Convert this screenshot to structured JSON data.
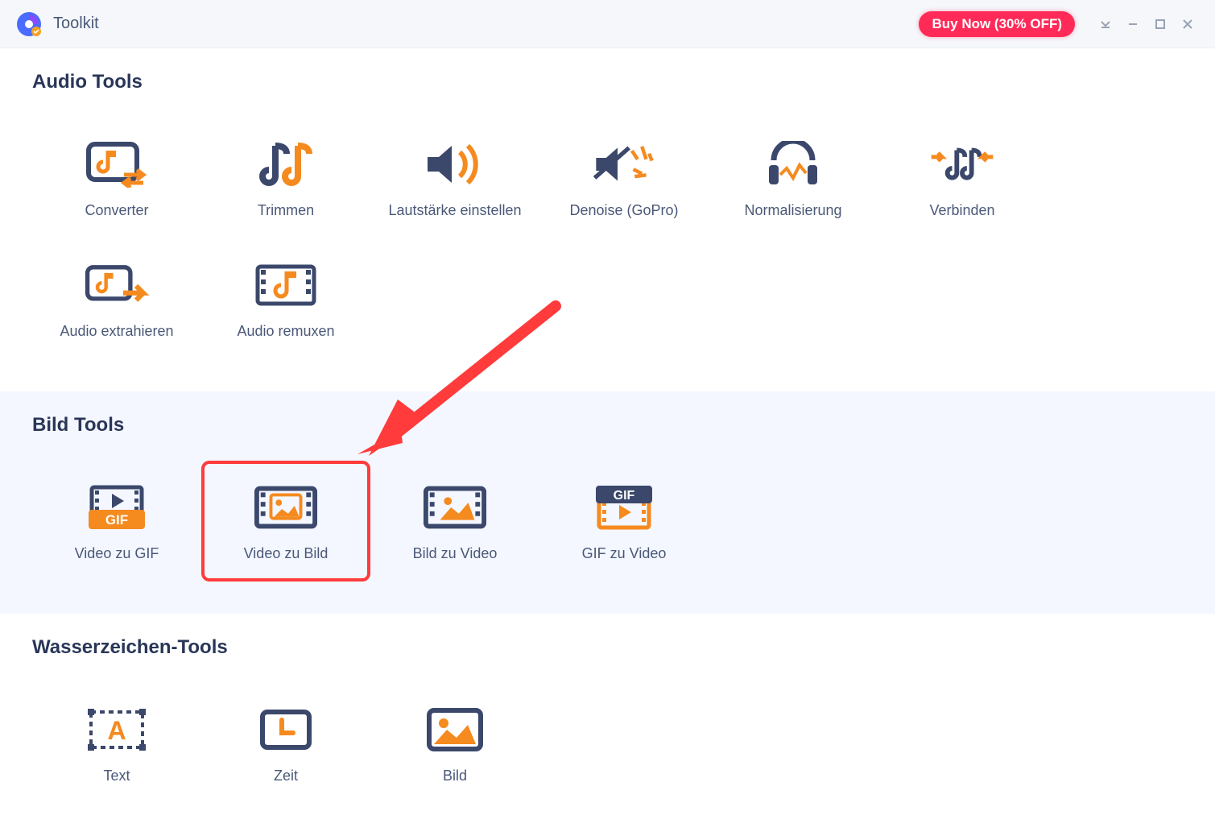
{
  "titlebar": {
    "title": "Toolkit",
    "buy_label": "Buy Now (30% OFF)"
  },
  "sections": {
    "audio": {
      "heading": "Audio Tools",
      "tools": [
        {
          "label": "Converter"
        },
        {
          "label": "Trimmen"
        },
        {
          "label": "Lautstärke einstellen"
        },
        {
          "label": "Denoise (GoPro)"
        },
        {
          "label": "Normalisierung"
        },
        {
          "label": "Verbinden"
        },
        {
          "label": "Audio extrahieren"
        },
        {
          "label": "Audio remuxen"
        }
      ]
    },
    "image": {
      "heading": "Bild Tools",
      "tools": [
        {
          "label": "Video zu GIF"
        },
        {
          "label": "Video zu Bild"
        },
        {
          "label": "Bild zu Video"
        },
        {
          "label": "GIF zu Video"
        }
      ]
    },
    "watermark": {
      "heading": "Wasserzeichen-Tools",
      "tools": [
        {
          "label": "Text"
        },
        {
          "label": "Zeit"
        },
        {
          "label": "Bild"
        }
      ]
    }
  },
  "colors": {
    "accent_orange": "#f58a1f",
    "accent_navy": "#3b486b",
    "brand_red": "#ff2a58",
    "highlight_red": "#ff3b3b"
  }
}
